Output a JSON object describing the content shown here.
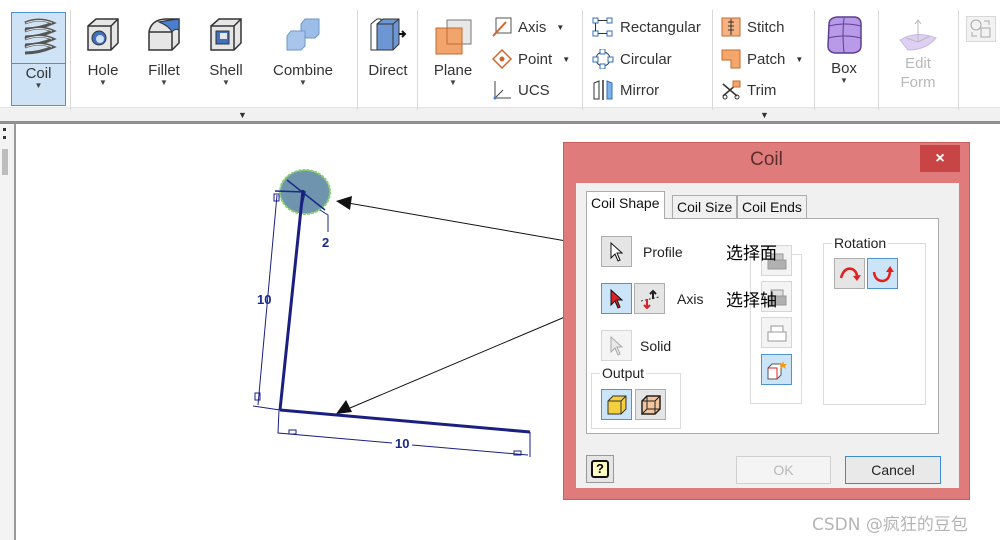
{
  "ribbon": {
    "coil": {
      "label": "Coil",
      "icon": "coil-spring-icon",
      "active": true
    },
    "modify_tools": [
      {
        "label": "Hole",
        "icon": "hole-icon"
      },
      {
        "label": "Fillet",
        "icon": "fillet-icon"
      },
      {
        "label": "Shell",
        "icon": "shell-icon"
      },
      {
        "label": "Combine",
        "icon": "combine-icon"
      },
      {
        "label": "Direct",
        "icon": "direct-edit-icon"
      }
    ],
    "plane": {
      "label": "Plane",
      "icon": "plane-icon"
    },
    "work_features": [
      {
        "label": "Axis",
        "icon": "axis-icon",
        "dropdown": true
      },
      {
        "label": "Point",
        "icon": "point-icon",
        "dropdown": true
      },
      {
        "label": "UCS",
        "icon": "ucs-icon",
        "dropdown": false
      }
    ],
    "pattern": [
      {
        "label": "Rectangular",
        "icon": "rectangular-pattern-icon"
      },
      {
        "label": "Circular",
        "icon": "circular-pattern-icon"
      },
      {
        "label": "Mirror",
        "icon": "mirror-icon"
      }
    ],
    "surface": [
      {
        "label": "Stitch",
        "icon": "stitch-icon",
        "dropdown": false
      },
      {
        "label": "Patch",
        "icon": "patch-icon",
        "dropdown": true
      },
      {
        "label": "Trim",
        "icon": "trim-icon",
        "dropdown": false
      }
    ],
    "freeform": [
      {
        "label": "Box",
        "icon": "freeform-box-icon",
        "enabled": true
      },
      {
        "label": "Edit Form",
        "line1": "Edit",
        "line2": "Form",
        "icon": "edit-form-icon",
        "enabled": false
      }
    ]
  },
  "sketch": {
    "dim_vertical": "10",
    "dim_horizontal": "10",
    "dim_diameter": "2"
  },
  "dialog": {
    "title": "Coil",
    "close_label": "×",
    "tabs": [
      {
        "label": "Coil Shape",
        "active": true
      },
      {
        "label": "Coil Size",
        "active": false
      },
      {
        "label": "Coil Ends",
        "active": false
      }
    ],
    "profile_label": "Profile",
    "axis_label": "Axis",
    "solid_label": "Solid",
    "output_label": "Output",
    "rotation_label": "Rotation",
    "ok_label": "OK",
    "cancel_label": "Cancel",
    "help_label": "?"
  },
  "annotations": {
    "select_face": "选择面",
    "select_axis": "选择轴"
  },
  "watermark": "CSDN @疯狂的豆包"
}
